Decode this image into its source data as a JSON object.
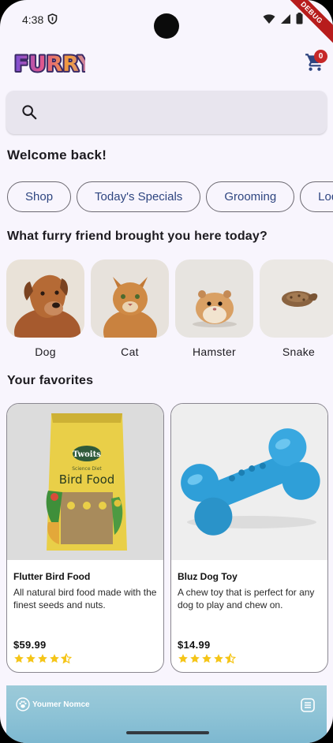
{
  "status": {
    "time": "4:38",
    "debug": "DEBUG"
  },
  "header": {
    "logo": "FURRY",
    "cart_count": "0"
  },
  "search": {
    "placeholder": ""
  },
  "welcome": "Welcome back!",
  "chips": [
    "Shop",
    "Today's Specials",
    "Grooming",
    "Lodging"
  ],
  "pets_title": "What furry friend brought you here today?",
  "pets": [
    {
      "label": "Dog"
    },
    {
      "label": "Cat"
    },
    {
      "label": "Hamster"
    },
    {
      "label": "Snake"
    }
  ],
  "favorites_title": "Your favorites",
  "products": [
    {
      "name": "Flutter Bird Food",
      "description": "All natural bird food made with the finest seeds and nuts.",
      "price": "$59.99",
      "rating": 4.5,
      "package_brand": "Twoits",
      "package_subtitle": "Science Diet",
      "package_title": "Bird Food"
    },
    {
      "name": "Bluz Dog Toy",
      "description": "A chew toy that is perfect for any dog to play and chew on.",
      "price": "$14.99",
      "rating": 4.5
    }
  ],
  "bottom": {
    "name": "Youmer Nomce"
  },
  "colors": {
    "accent": "#2e4580",
    "background": "#f8f5fd",
    "badge": "#c62828",
    "star": "#f5c518"
  }
}
